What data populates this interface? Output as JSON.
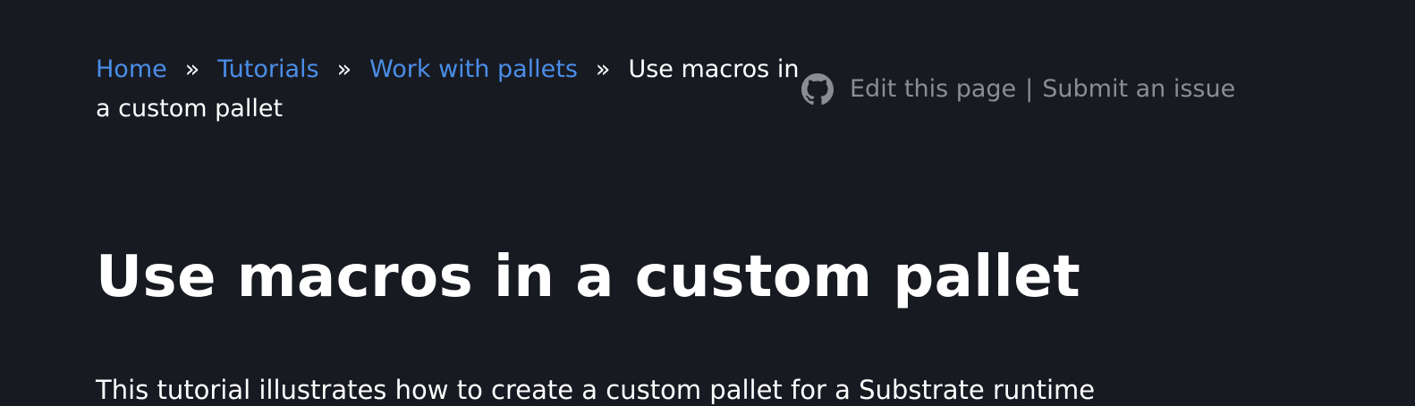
{
  "breadcrumb": {
    "items": [
      {
        "label": "Home"
      },
      {
        "label": "Tutorials"
      },
      {
        "label": "Work with pallets"
      }
    ],
    "separator": "»",
    "current": "Use macros in a custom pallet"
  },
  "edit_links": {
    "icon": "github-icon",
    "edit_label": "Edit this page",
    "divider": "|",
    "issue_label": "Submit an issue"
  },
  "main": {
    "title": "Use macros in a custom pallet",
    "intro": "This tutorial illustrates how to create a custom pallet for a Substrate runtime"
  },
  "colors": {
    "background": "#181a22",
    "link": "#4a8ee8",
    "muted": "#8b8d95",
    "text": "#ffffff"
  }
}
